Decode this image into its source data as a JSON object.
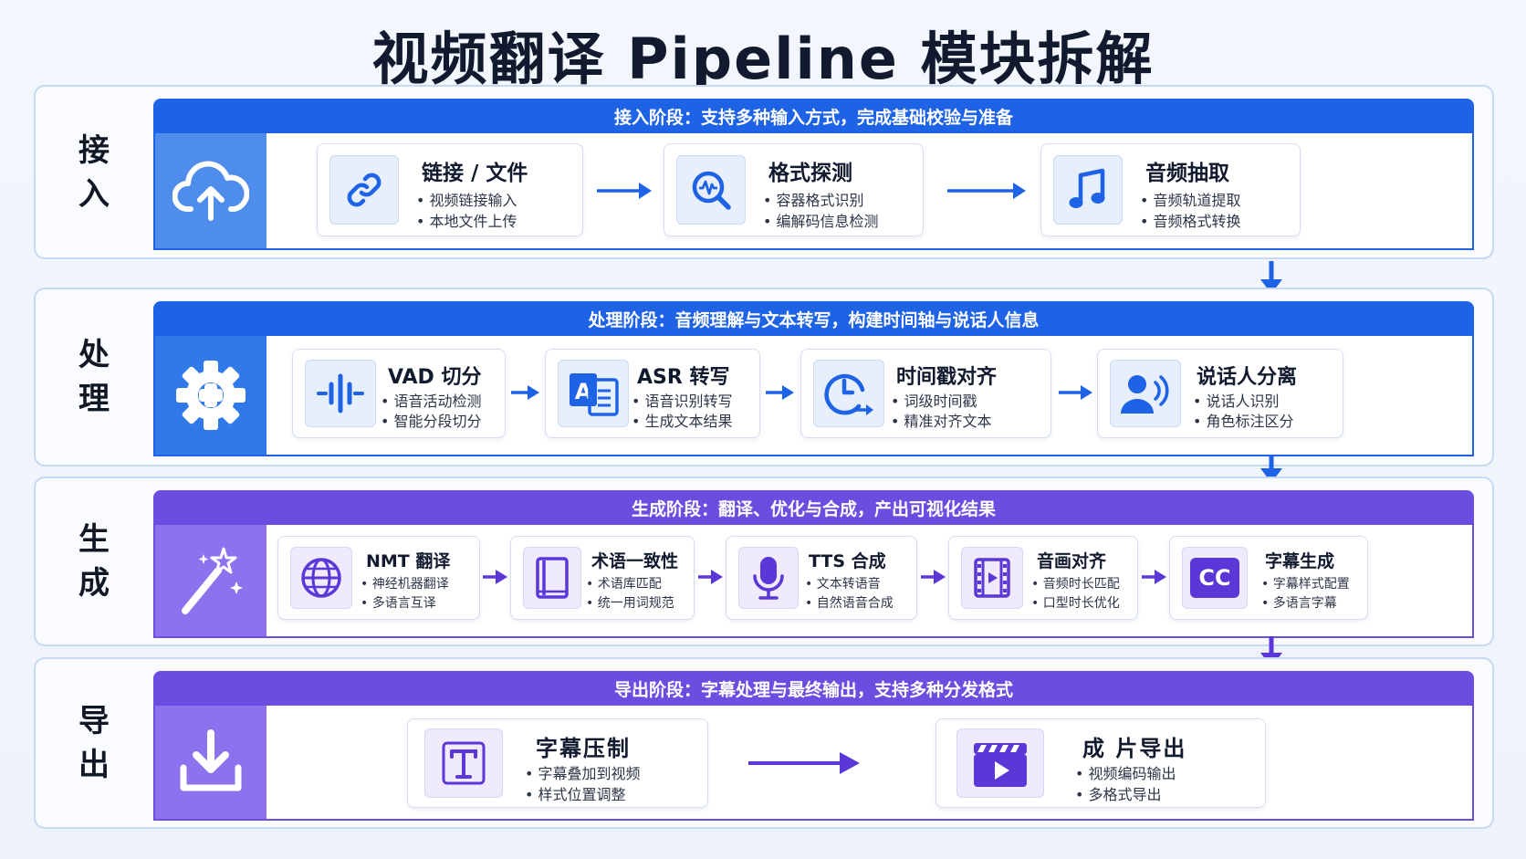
{
  "title": "视频翻译 Pipeline 模块拆解",
  "colors": {
    "blue": "#1e63e6",
    "blue_block": "#4f8ded",
    "purple": "#6b4ee0",
    "purple_block": "#8c72ec"
  },
  "stages": [
    {
      "label": "接入",
      "banner": "接入阶段：支持多种输入方式，完成基础校验与准备",
      "icon": "cloud-upload-icon",
      "cards": [
        {
          "title": "链接 / 文件",
          "bullets": [
            "• 视频链接输入",
            "• 本地文件上传"
          ],
          "icon": "link-icon"
        },
        {
          "title": "格式探测",
          "bullets": [
            "• 容器格式识别",
            "• 编解码信息检测"
          ],
          "icon": "magnifier-wave-icon"
        },
        {
          "title": "音频抽取",
          "bullets": [
            "• 音频轨道提取",
            "• 音频格式转换"
          ],
          "icon": "music-note-icon"
        }
      ]
    },
    {
      "label": "处理",
      "banner": "处理阶段：音频理解与文本转写，构建时间轴与说话人信息",
      "icon": "gear-icon",
      "cards": [
        {
          "title": "VAD 切分",
          "bullets": [
            "• 语音活动检测",
            "• 智能分段切分"
          ],
          "icon": "waveform-icon"
        },
        {
          "title": "ASR 转写",
          "bullets": [
            "• 语音识别转写",
            "• 生成文本结果"
          ],
          "icon": "text-recognition-icon"
        },
        {
          "title": "时间戳对齐",
          "bullets": [
            "• 词级时间戳",
            "• 精准对齐文本"
          ],
          "icon": "clock-arrow-icon"
        },
        {
          "title": "说话人分离",
          "bullets": [
            "• 说话人识别",
            "• 角色标注区分"
          ],
          "icon": "speaker-icon"
        }
      ]
    },
    {
      "label": "生成",
      "banner": "生成阶段：翻译、优化与合成，产出可视化结果",
      "icon": "magic-wand-icon",
      "cards": [
        {
          "title": "NMT 翻译",
          "bullets": [
            "• 神经机器翻译",
            "• 多语言互译"
          ],
          "icon": "globe-icon"
        },
        {
          "title": "术语一致性",
          "bullets": [
            "• 术语库匹配",
            "• 统一用词规范"
          ],
          "icon": "book-icon"
        },
        {
          "title": "TTS 合成",
          "bullets": [
            "• 文本转语音",
            "• 自然语音合成"
          ],
          "icon": "microphone-icon"
        },
        {
          "title": "音画对齐",
          "bullets": [
            "• 音频时长匹配",
            "• 口型时长优化"
          ],
          "icon": "film-icon"
        },
        {
          "title": "字幕生成",
          "bullets": [
            "• 字幕样式配置",
            "• 多语言字幕"
          ],
          "icon": "cc-icon",
          "icon_text": "CC"
        }
      ]
    },
    {
      "label": "导出",
      "banner": "导出阶段：字幕处理与最终输出，支持多种分发格式",
      "icon": "download-icon",
      "cards": [
        {
          "title": "字幕压制",
          "bullets": [
            "• 字幕叠加到视频",
            "• 样式位置调整"
          ],
          "icon": "text-t-icon"
        },
        {
          "title": "成 片导出",
          "bullets": [
            "• 视频编码输出",
            "• 多格式导出"
          ],
          "icon": "clapperboard-icon"
        }
      ]
    }
  ]
}
